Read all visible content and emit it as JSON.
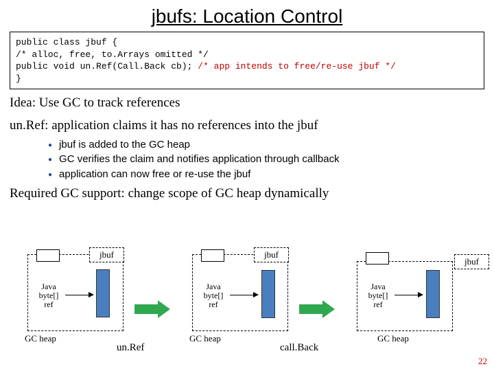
{
  "title": "jbufs: Location Control",
  "code": {
    "l1": "public class jbuf {",
    "l2": " /* alloc, free, to.Arrays omitted */",
    "l3a": " public void un.Ref(Call.Back cb); ",
    "l3b": "/* app intends to free/re-use jbuf */",
    "l4": "}"
  },
  "idea1": "Idea: Use GC to track references",
  "idea2": "un.Ref: application claims it has no references into the jbuf",
  "bullets": {
    "b1": "jbuf is added to the GC heap",
    "b2": "GC verifies the claim and notifies application through callback",
    "b3": "application can now free or re-use the jbuf"
  },
  "required": "Required GC support: change scope of GC heap dynamically",
  "jbuf_label": "jbuf",
  "ref_label": "Java\nbyte[]\nref",
  "gcheap": "GC heap",
  "caption_unref": "un.Ref",
  "caption_callback": "call.Back",
  "pagenum": "22"
}
